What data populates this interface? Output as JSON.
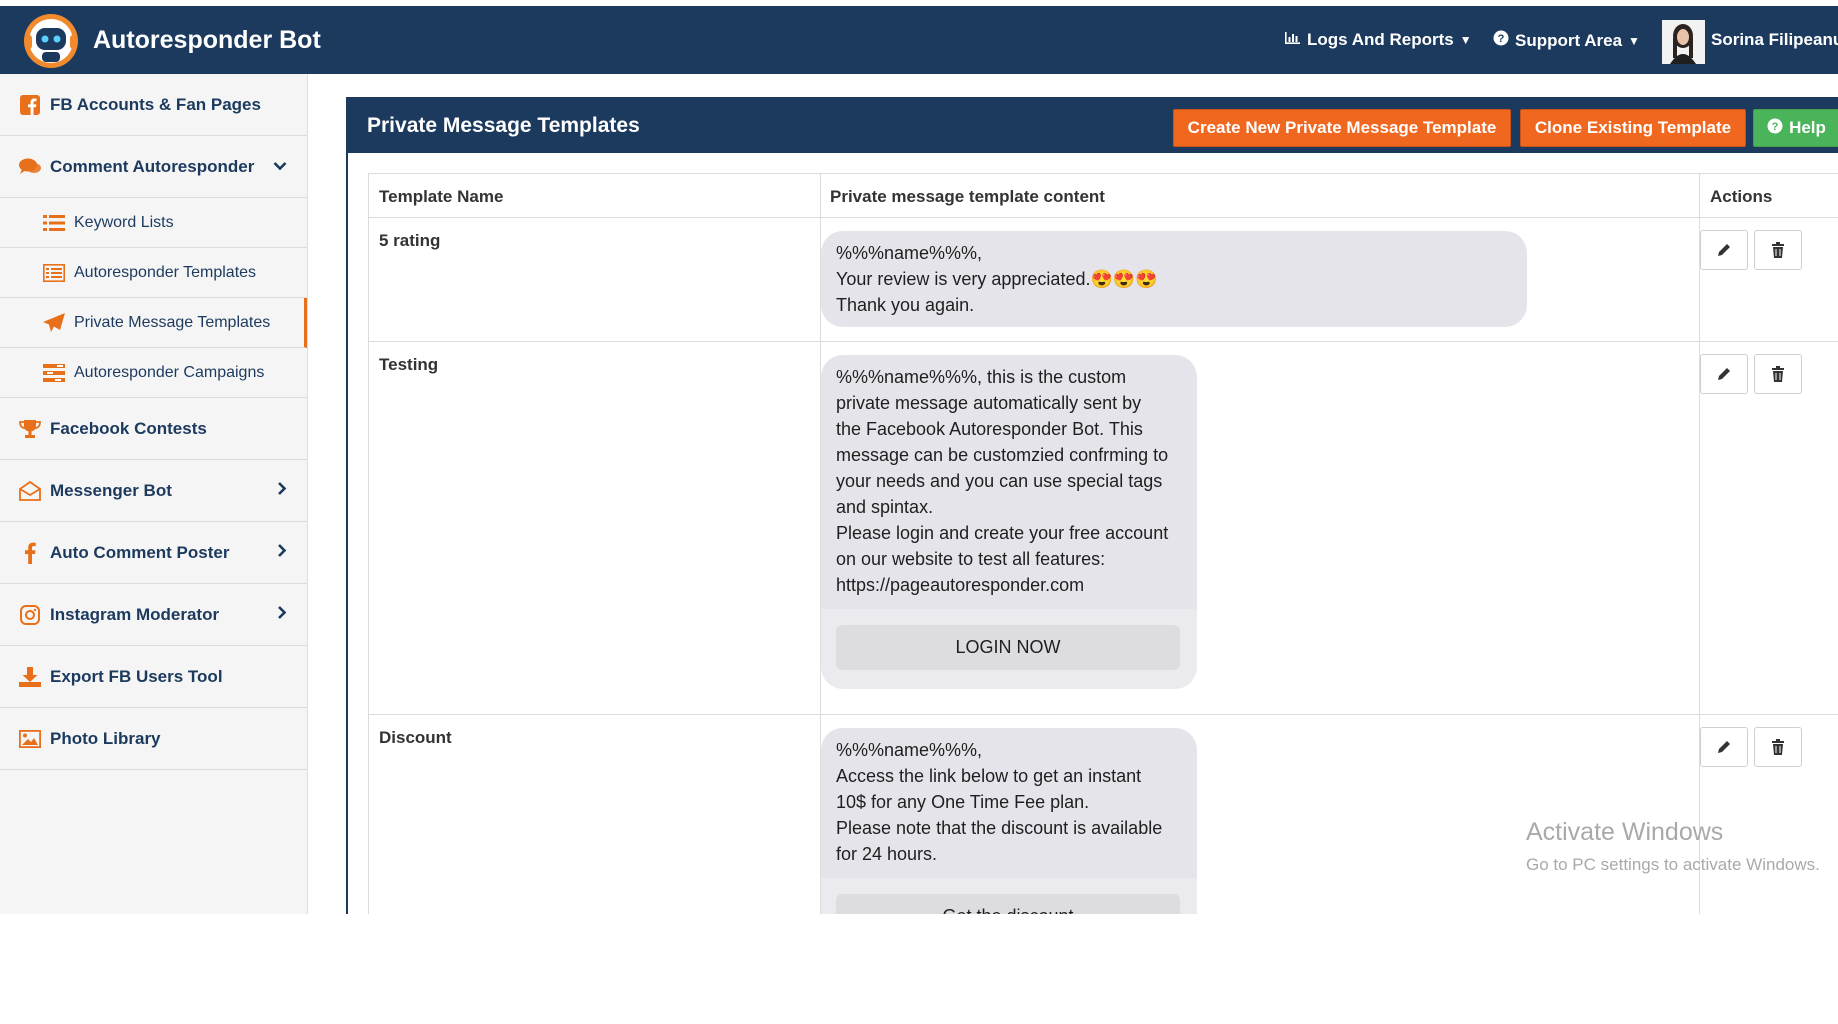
{
  "header": {
    "brand": "Autoresponder Bot",
    "nav": [
      {
        "label": "Logs And Reports",
        "icon": "bar-chart-icon"
      },
      {
        "label": "Support Area",
        "icon": "question-circle-icon"
      }
    ],
    "user_name": "Sorina Filipeanu"
  },
  "sidebar": {
    "items": [
      {
        "label": "FB Accounts & Fan Pages",
        "icon": "facebook-square-icon"
      },
      {
        "label": "Comment Autoresponder",
        "icon": "comments-icon",
        "chevron": "chevron-down-icon"
      },
      {
        "label": "Keyword Lists",
        "icon": "list-icon"
      },
      {
        "label": "Autoresponder Templates",
        "icon": "list-alt-icon"
      },
      {
        "label": "Private Message Templates",
        "icon": "paper-plane-icon",
        "active": true
      },
      {
        "label": "Autoresponder Campaigns",
        "icon": "tasks-icon"
      },
      {
        "label": "Facebook Contests",
        "icon": "trophy-icon"
      },
      {
        "label": "Messenger Bot",
        "icon": "envelope-open-icon",
        "chevron": "chevron-right-icon"
      },
      {
        "label": "Auto Comment Poster",
        "icon": "facebook-f-icon",
        "chevron": "chevron-right-icon"
      },
      {
        "label": "Instagram Moderator",
        "icon": "instagram-icon",
        "chevron": "chevron-right-icon"
      },
      {
        "label": "Export FB Users Tool",
        "icon": "download-icon"
      },
      {
        "label": "Photo Library",
        "icon": "image-icon"
      }
    ]
  },
  "panel": {
    "title": "Private Message Templates",
    "buttons": {
      "create": "Create New Private Message Template",
      "clone": "Clone Existing Template",
      "help": "Help"
    }
  },
  "table": {
    "headers": [
      "Template Name",
      "Private message template content",
      "Actions"
    ],
    "rows": [
      {
        "name": "5 rating",
        "content": "%%%name%%%,\nYour review is very appreciated.😍😍😍\nThank you again."
      },
      {
        "name": "Testing",
        "content": "%%%name%%%, this is the custom\nprivate message automatically sent by\nthe Facebook Autoresponder Bot. This\nmessage can be customzied confrming to\nyour needs and you can use special tags\nand spintax.\nPlease login and create your free account\non our website to test all features:\nhttps://pageautoresponder.com",
        "button": "LOGIN NOW"
      },
      {
        "name": "Discount",
        "content": "%%%name%%%,\nAccess the link below to get an instant\n10$ for any One Time Fee plan.\nPlease note that the discount is available\nfor 24 hours.",
        "button": "Get the discount"
      }
    ]
  },
  "watermark": {
    "line1": "Activate Windows",
    "line2": "Go to PC settings to activate Windows."
  },
  "colors": {
    "header_bg": "#1c3a5e",
    "accent_orange": "#f0671f",
    "help_green": "#49b45a",
    "bubble_bg": "#e4e4ea"
  }
}
